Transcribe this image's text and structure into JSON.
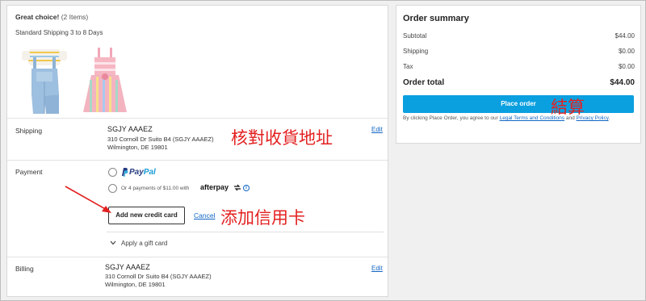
{
  "cart": {
    "header_bold": "Great choice!",
    "header_count": "(2 Items)",
    "shipping_note": "Standard Shipping 3 to 8 Days",
    "products": [
      {
        "name": "denim-overalls-outfit"
      },
      {
        "name": "striped-dress-outfit"
      }
    ]
  },
  "shipping": {
    "label": "Shipping",
    "name": "SGJY AAAEZ",
    "address_line1": "310 Cornoll Dr Suito B4 (SGJY AAAEZ)",
    "address_line2": "Wilmington, DE 19801",
    "edit_label": "Edit"
  },
  "payment": {
    "label": "Payment",
    "paypal_part1": "Pay",
    "paypal_part2": "Pal",
    "afterpay_text": "Or 4 payments of $11.00 with",
    "afterpay_logo": "afterpay",
    "info_glyph": "i",
    "add_card_label": "Add new credit card",
    "cancel_label": "Cancel",
    "gift_card_label": "Apply a gift card"
  },
  "billing": {
    "label": "Billing",
    "name": "SGJY AAAEZ",
    "address_line1": "310 Cornoll Dr Suito B4 (SGJY AAAEZ)",
    "address_line2": "Wilmington, DE 19801",
    "edit_label": "Edit"
  },
  "summary": {
    "title": "Order summary",
    "rows": [
      {
        "label": "Subtotal",
        "value": "$44.00"
      },
      {
        "label": "Shipping",
        "value": "$0.00"
      },
      {
        "label": "Tax",
        "value": "$0.00"
      }
    ],
    "total_label": "Order total",
    "total_value": "$44.00",
    "place_order_label": "Place order",
    "terms_prefix": "By clicking Place Order, you agree to our",
    "terms_link1": "Legal Terms and Conditions",
    "terms_and": "and",
    "terms_link2": "Privacy Policy",
    "terms_suffix": "."
  },
  "annotations": {
    "verify_address": "核對收貨地址",
    "add_credit_card": "添加信用卡",
    "checkout": "結算"
  },
  "colors": {
    "accent_button": "#0aa0e0",
    "link": "#1266c4",
    "annotation_red": "#e32020",
    "paypal_dark": "#253b80",
    "paypal_light": "#179bd7"
  }
}
